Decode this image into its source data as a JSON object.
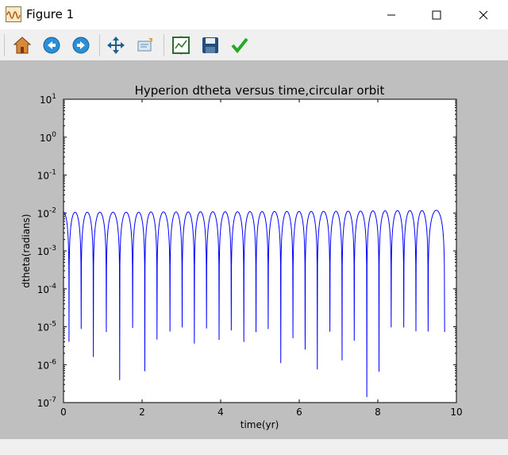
{
  "window": {
    "title": "Figure 1",
    "controls": [
      "minimize",
      "maximize",
      "close"
    ]
  },
  "toolbar": {
    "tools": [
      {
        "name": "home",
        "icon": "home-icon"
      },
      {
        "name": "back",
        "icon": "back-arrow-icon"
      },
      {
        "name": "forward",
        "icon": "forward-arrow-icon"
      },
      {
        "name": "pan",
        "icon": "pan-arrows-icon"
      },
      {
        "name": "zoom",
        "icon": "zoom-rect-icon"
      },
      {
        "name": "configure-subplots",
        "icon": "subplots-icon"
      },
      {
        "name": "save",
        "icon": "save-disk-icon"
      },
      {
        "name": "edit",
        "icon": "checkmark-icon"
      }
    ]
  },
  "colors": {
    "figure_bg": "#bfbfbf",
    "plot_bg": "#ffffff",
    "line": "#0000ff"
  },
  "chart_data": {
    "type": "line",
    "title": "Hyperion dtheta versus time,circular orbit",
    "xlabel": "time(yr)",
    "ylabel": "dtheta(radians)",
    "xlim": [
      0,
      10
    ],
    "ylim": [
      1e-07,
      10
    ],
    "yscale": "log",
    "grid": false,
    "xticks": [
      0,
      2,
      4,
      6,
      8,
      10
    ],
    "xtick_labels": [
      "0",
      "2",
      "4",
      "6",
      "8",
      "10"
    ],
    "ytick_exponents": [
      1,
      0,
      -1,
      -2,
      -3,
      -4,
      -5,
      -6,
      -7
    ],
    "ytick_base": "10",
    "peak_times": [
      0,
      0.62,
      1.25,
      1.87,
      2.5,
      3.12,
      3.75,
      4.37,
      5.0,
      5.62,
      6.24,
      6.87,
      7.49,
      8.12,
      8.74,
      9.57
    ],
    "peak_values": [
      0.0105,
      0.0105,
      0.0105,
      0.0105,
      0.0107,
      0.0107,
      0.0108,
      0.0108,
      0.0109,
      0.011,
      0.011,
      0.0111,
      0.0112,
      0.0114,
      0.0116,
      0.0118
    ],
    "dips": [
      {
        "t": 0.14,
        "v": 4e-06
      },
      {
        "t": 0.45,
        "v": 8.8e-06
      },
      {
        "t": 0.76,
        "v": 1.6e-06
      },
      {
        "t": 1.09,
        "v": 7.3e-06
      },
      {
        "t": 1.43,
        "v": 3.9e-07
      },
      {
        "t": 1.76,
        "v": 9.3e-06
      },
      {
        "t": 2.07,
        "v": 6.7e-07
      },
      {
        "t": 2.38,
        "v": 4.6e-06
      },
      {
        "t": 2.71,
        "v": 7.5e-06
      },
      {
        "t": 3.02,
        "v": 9.6e-06
      },
      {
        "t": 3.33,
        "v": 3.6e-06
      },
      {
        "t": 3.64,
        "v": 9e-06
      },
      {
        "t": 3.96,
        "v": 4.5e-06
      },
      {
        "t": 4.27,
        "v": 8e-06
      },
      {
        "t": 4.59,
        "v": 4e-06
      },
      {
        "t": 4.9,
        "v": 7.2e-06
      },
      {
        "t": 5.21,
        "v": 8.7e-06
      },
      {
        "t": 5.53,
        "v": 1.1e-06
      },
      {
        "t": 5.84,
        "v": 5e-06
      },
      {
        "t": 6.15,
        "v": 2.5e-06
      },
      {
        "t": 6.46,
        "v": 7.5e-07
      },
      {
        "t": 6.78,
        "v": 7.4e-06
      },
      {
        "t": 7.09,
        "v": 1.3e-06
      },
      {
        "t": 7.4,
        "v": 4.3e-06
      },
      {
        "t": 7.72,
        "v": 1.4e-07
      },
      {
        "t": 8.03,
        "v": 6.5e-07
      },
      {
        "t": 8.34,
        "v": 9.6e-06
      },
      {
        "t": 8.66,
        "v": 9.6e-06
      },
      {
        "t": 8.97,
        "v": 7.6e-06
      },
      {
        "t": 9.28,
        "v": 7.5e-06
      },
      {
        "t": 9.7,
        "v": 7.3e-06
      }
    ]
  }
}
